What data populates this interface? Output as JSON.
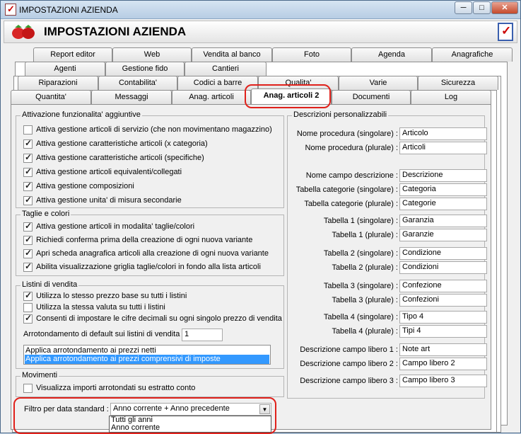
{
  "window": {
    "title": "IMPOSTAZIONI AZIENDA",
    "btn_min": "─",
    "btn_max": "□",
    "btn_close": "✕"
  },
  "header": {
    "title": "IMPOSTAZIONI AZIENDA"
  },
  "tabs": {
    "row1": [
      "Report editor",
      "Web",
      "Vendita al banco",
      "Foto",
      "Agenda",
      "Anagrafiche"
    ],
    "row2": [
      "Agenti",
      "Gestione fido",
      "Cantieri"
    ],
    "row3": [
      "Riparazioni",
      "Contabilita'",
      "Codici a barre",
      "Qualita'",
      "Varie",
      "Sicurezza"
    ],
    "row4": [
      "Quantita'",
      "Messaggi",
      "Anag. articoli",
      "Anag. articoli 2",
      "Documenti",
      "Log"
    ]
  },
  "functional": {
    "title": "Attivazione funzionalita' aggiuntive",
    "items": [
      {
        "label": "Attiva gestione articoli di servizio (che non movimentano magazzino)",
        "checked": false
      },
      {
        "label": "Attiva gestione caratteristiche articoli (x categoria)",
        "checked": true
      },
      {
        "label": "Attiva gestione caratteristiche articoli (specifiche)",
        "checked": true
      },
      {
        "label": "Attiva gestione articoli equivalenti/collegati",
        "checked": true
      },
      {
        "label": "Attiva gestione composizioni",
        "checked": true
      },
      {
        "label": "Attiva gestione unita' di misura secondarie",
        "checked": true
      }
    ]
  },
  "taglie": {
    "title": "Taglie e colori",
    "items": [
      {
        "label": "Attiva gestione articoli in modalita' taglie/colori",
        "checked": true
      },
      {
        "label": "Richiedi conferma prima della creazione di ogni nuova variante",
        "checked": true
      },
      {
        "label": "Apri scheda anagrafica articoli alla creazione di ogni nuova variante",
        "checked": true
      },
      {
        "label": "Abilita visualizzazione griglia taglie/colori in fondo alla lista articoli",
        "checked": true
      }
    ]
  },
  "listini": {
    "title": "Listini di vendita",
    "items": [
      {
        "label": "Utilizza lo stesso prezzo base su tutti i listini",
        "checked": true
      },
      {
        "label": "Utilizza la stessa valuta su tutti i listini",
        "checked": false
      },
      {
        "label": "Consenti di impostare le cifre decimali su ogni singolo prezzo di vendita",
        "checked": true
      }
    ],
    "rounding_label": "Arrotondamento di default sui listini di vendita :",
    "rounding_value": "1",
    "options": [
      "Applica arrotondamento ai prezzi netti",
      "Applica arrotondamento ai prezzi comprensivi di imposte"
    ],
    "selected_option": 1
  },
  "movimenti": {
    "title": "Movimenti",
    "items": [
      {
        "label": "Visualizza importi arrotondati su estratto conto",
        "checked": false
      }
    ]
  },
  "filter": {
    "label": "Filtro per data standard :",
    "value": "Anno corrente + Anno precedente",
    "options": [
      "Tutti gli anni",
      "Anno corrente"
    ]
  },
  "descrizioni": {
    "title": "Descrizioni personalizzabili",
    "fields": [
      {
        "label": "Nome procedura (singolare) :",
        "value": "Articolo"
      },
      {
        "label": "Nome procedura (plurale) :",
        "value": "Articoli"
      },
      {
        "label": "Nome campo descrizione :",
        "value": "Descrizione"
      },
      {
        "label": "Tabella categorie (singolare) :",
        "value": "Categoria"
      },
      {
        "label": "Tabella categorie (plurale) :",
        "value": "Categorie"
      },
      {
        "label": "Tabella 1 (singolare) :",
        "value": "Garanzia"
      },
      {
        "label": "Tabella 1 (plurale) :",
        "value": "Garanzie"
      },
      {
        "label": "Tabella 2 (singolare) :",
        "value": "Condizione"
      },
      {
        "label": "Tabella 2 (plurale) :",
        "value": "Condizioni"
      },
      {
        "label": "Tabella 3 (singolare) :",
        "value": "Confezione"
      },
      {
        "label": "Tabella 3 (plurale) :",
        "value": "Confezioni"
      },
      {
        "label": "Tabella 4 (singolare) :",
        "value": "Tipo 4"
      },
      {
        "label": "Tabella 4 (plurale) :",
        "value": "Tipi 4"
      },
      {
        "label": "Descrizione campo libero 1 :",
        "value": "Note art"
      },
      {
        "label": "Descrizione campo libero 2 :",
        "value": "Campo libero 2"
      },
      {
        "label": "Descrizione campo libero 3 :",
        "value": "Campo libero 3"
      }
    ]
  }
}
